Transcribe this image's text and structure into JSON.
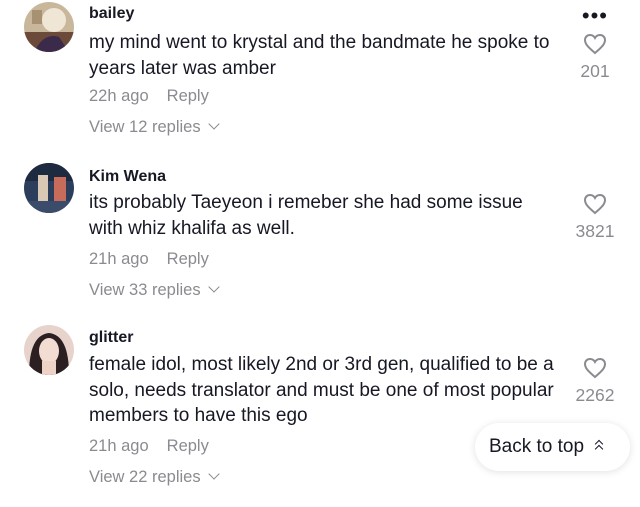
{
  "comments": [
    {
      "username": "bailey",
      "text": "my mind went to krystal and the bandmate he spoke to years later was amber",
      "time": "22h ago",
      "reply_label": "Reply",
      "view_replies": "View 12 replies",
      "likes": "201"
    },
    {
      "username": "Kim Wena",
      "text": "its probably Taeyeon i remeber she had some issue with whiz khalifa as well.",
      "time": "21h ago",
      "reply_label": "Reply",
      "view_replies": "View 33 replies",
      "likes": "3821"
    },
    {
      "username": "glitter",
      "text": "female idol, most likely 2nd or 3rd gen, qualified to be a solo, needs translator and must be one of most popular members to have this ego",
      "time": "21h ago",
      "reply_label": "Reply",
      "view_replies": "View 22 replies",
      "likes": "2262"
    }
  ],
  "more_menu": "•••",
  "back_to_top": "Back to top",
  "icons": {
    "like": "heart-outline-icon",
    "more": "ellipsis-icon",
    "chevron": "chevron-down-icon",
    "back_to_top": "double-chevron-up-icon"
  },
  "colors": {
    "text": "#161823",
    "muted": "#8a8b91",
    "background": "#ffffff"
  }
}
